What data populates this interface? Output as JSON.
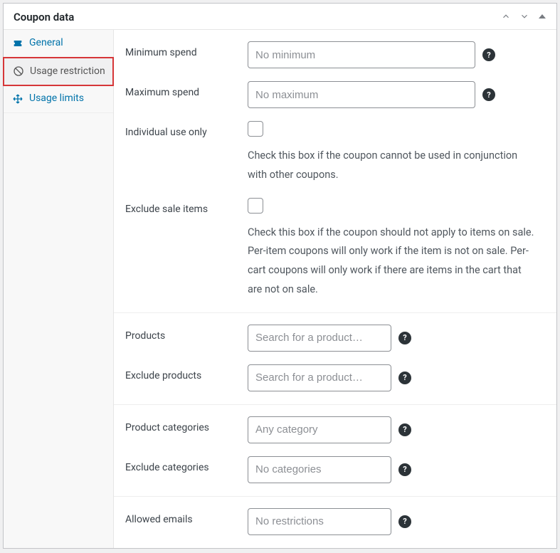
{
  "panel": {
    "title": "Coupon data"
  },
  "tabs": {
    "general": "General",
    "usage_restriction": "Usage restriction",
    "usage_limits": "Usage limits"
  },
  "fields": {
    "min_spend": {
      "label": "Minimum spend",
      "placeholder": "No minimum"
    },
    "max_spend": {
      "label": "Maximum spend",
      "placeholder": "No maximum"
    },
    "individual_use": {
      "label": "Individual use only",
      "desc": "Check this box if the coupon cannot be used in conjunction with other coupons."
    },
    "exclude_sale": {
      "label": "Exclude sale items",
      "desc": "Check this box if the coupon should not apply to items on sale. Per-item coupons will only work if the item is not on sale. Per-cart coupons will only work if there are items in the cart that are not on sale."
    },
    "products": {
      "label": "Products",
      "placeholder": "Search for a product…"
    },
    "exclude_products": {
      "label": "Exclude products",
      "placeholder": "Search for a product…"
    },
    "product_categories": {
      "label": "Product categories",
      "placeholder": "Any category"
    },
    "exclude_categories": {
      "label": "Exclude categories",
      "placeholder": "No categories"
    },
    "allowed_emails": {
      "label": "Allowed emails",
      "placeholder": "No restrictions"
    }
  },
  "help_glyph": "?"
}
